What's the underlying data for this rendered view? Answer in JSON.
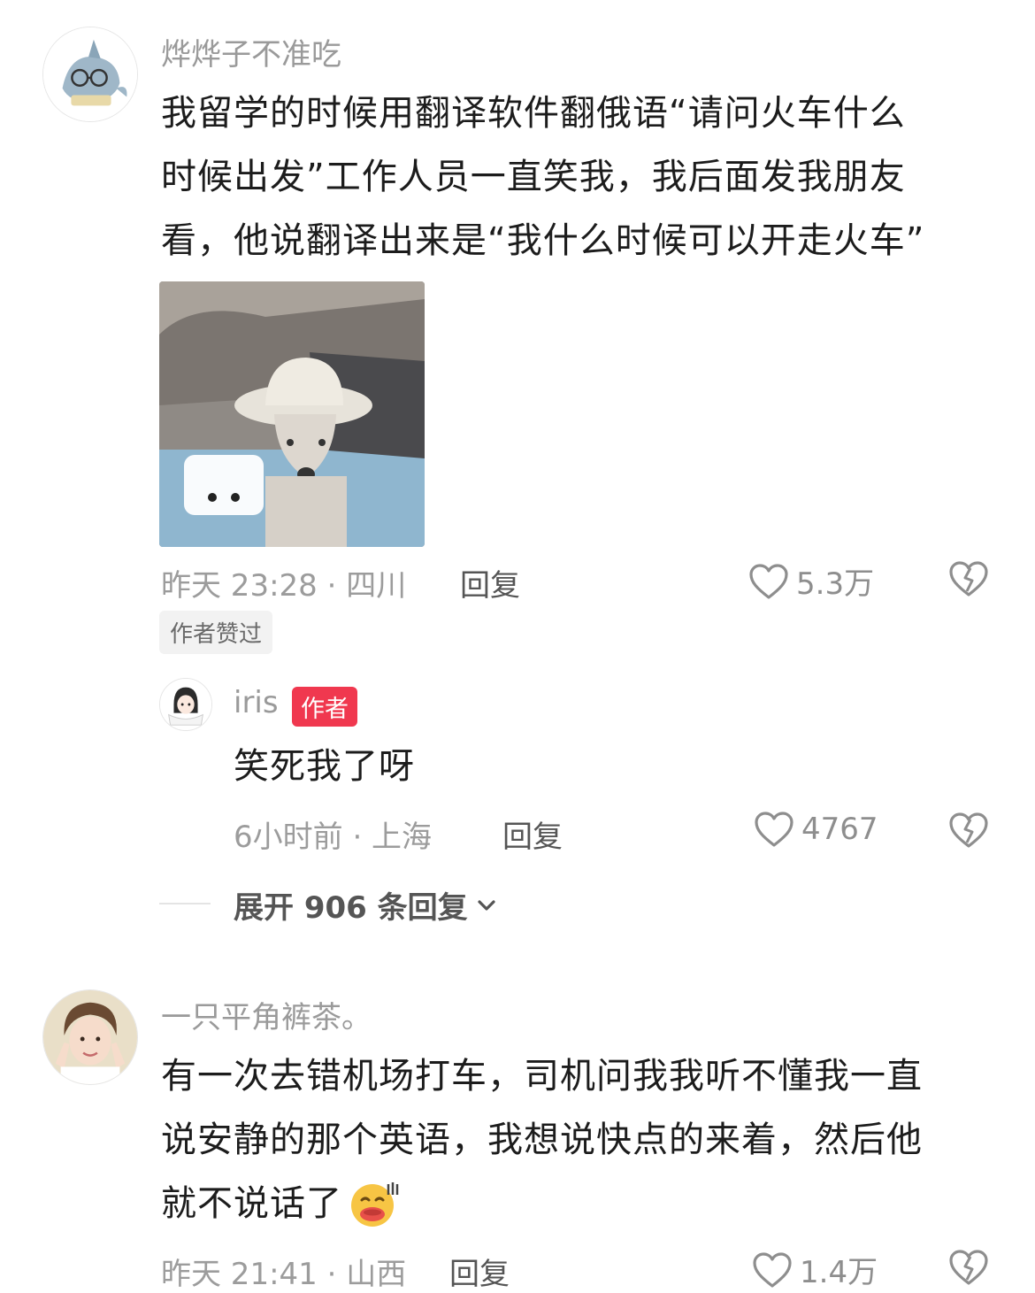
{
  "comments": [
    {
      "username": "烨烨子不准吃",
      "content_lines": [
        "我留学的时候用翻译软件翻俄语“请问火车什么",
        "时候出发”工作人员一直笑我，我后面发我朋友",
        "看，他说翻译出来是“我什么时候可以开走火车”"
      ],
      "time_location": "昨天 23:28 · 四川",
      "reply_label": "回复",
      "likes": "5.3万",
      "liked_badge": "作者赞过",
      "avatar_icon": "shark-plush-avatar",
      "image_icon": "dog-in-hat-meme"
    },
    {
      "username": "一只平角裤茶。",
      "content_lines": [
        "有一次去错机场打车，司机问我我听不懂我一直",
        "说安静的那个英语，我想说快点的来着，然后他",
        "就不说话了"
      ],
      "time_location": "昨天 21:41 · 山西",
      "reply_label": "回复",
      "likes": "1.4万",
      "avatar_icon": "person-peace-sign-avatar",
      "emoji_icon": "laughing-sweat-emoji"
    }
  ],
  "reply": {
    "username": "iris",
    "author_tag": "作者",
    "content": "笑死我了呀",
    "time_location": "6小时前 · 上海",
    "reply_label": "回复",
    "likes": "4767",
    "avatar_icon": "girl-cartoon-avatar"
  },
  "expand": {
    "label": "展开 906 条回复"
  },
  "colors": {
    "accent_red": "#f0384f",
    "meta_gray": "#9c9c9c"
  }
}
